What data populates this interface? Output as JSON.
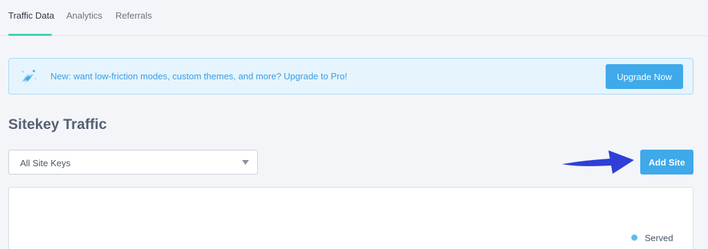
{
  "tabs": [
    {
      "label": "Traffic Data",
      "active": true
    },
    {
      "label": "Analytics",
      "active": false
    },
    {
      "label": "Referrals",
      "active": false
    }
  ],
  "banner": {
    "icon": "lightning-bolt-icon",
    "text": "New: want low-friction modes, custom themes, and more? Upgrade to Pro!",
    "button_label": "Upgrade Now"
  },
  "section": {
    "title": "Sitekey Traffic"
  },
  "site_select": {
    "value": "All Site Keys",
    "icon": "chevron-down-icon"
  },
  "add_site": {
    "label": "Add Site"
  },
  "chart": {
    "legend": [
      {
        "label": "Served",
        "color": "#5bbef0"
      }
    ]
  },
  "colors": {
    "accent": "#3fa9ea",
    "tab_underline": "#3ed3b1",
    "banner_bg": "#e6f4fd",
    "banner_text": "#3a9de3",
    "annotation_arrow": "#2f3fd8"
  }
}
